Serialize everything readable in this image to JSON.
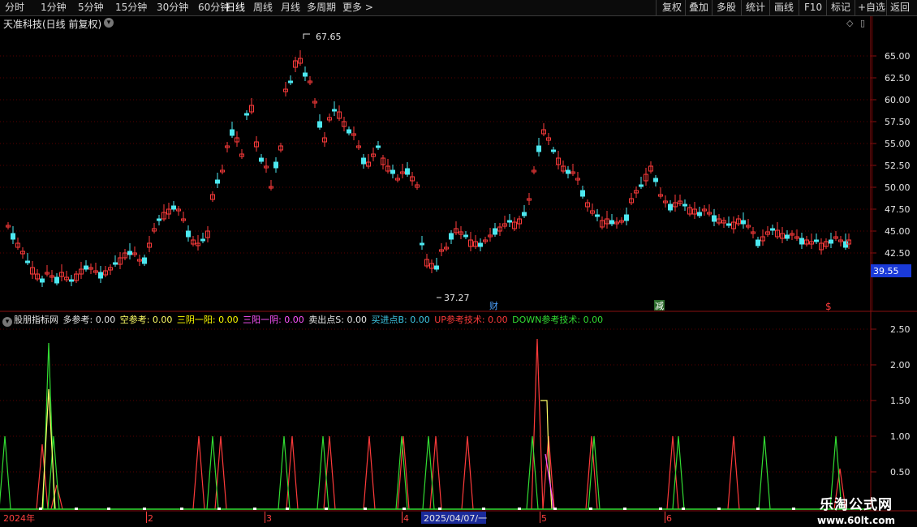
{
  "toolbar": {
    "periods": [
      "分时",
      "1分钟",
      "5分钟",
      "15分钟",
      "30分钟",
      "60分钟",
      "日线",
      "周线",
      "月线",
      "多周期",
      "更多 >"
    ],
    "active": "日线",
    "buttons": [
      "复权",
      "叠加",
      "多股",
      "统计",
      "画线",
      "F10",
      "标记",
      "+自选",
      "返回"
    ]
  },
  "chart": {
    "title": "天准科技(日线 前复权)",
    "price_axis_ticks": [
      "65.00",
      "62.50",
      "60.00",
      "57.50",
      "55.00",
      "52.50",
      "50.00",
      "47.50",
      "45.00",
      "42.50"
    ],
    "current_price": "39.55",
    "high_label": "67.65",
    "low_label": "37.27",
    "markers": [
      {
        "text": "财",
        "color": "#4da3ff"
      },
      {
        "text": "减",
        "color": "#ffffff",
        "bg": "#2a6a2a"
      },
      {
        "text": "$",
        "color": "#ff3b3b"
      }
    ],
    "colors": {
      "up": "#ff3b3b",
      "down": "#4de8f0",
      "grid": "#5a0000",
      "axis": "#8a1010"
    }
  },
  "indicator": {
    "name": "股朋指标网",
    "items": [
      {
        "label": "多参考: 0.00",
        "color": "#e6e6e6"
      },
      {
        "label": "空参考: 0.00",
        "color": "#ffff66"
      },
      {
        "label": "三阴一阳: 0.00",
        "color": "#ffff00"
      },
      {
        "label": "三阳一阴: 0.00",
        "color": "#ff55ff"
      },
      {
        "label": "卖出点S: 0.00",
        "color": "#e6e6e6"
      },
      {
        "label": "买进点B: 0.00",
        "color": "#3ec9e6"
      },
      {
        "label": "UP参考技术: 0.00",
        "color": "#ff3b3b"
      },
      {
        "label": "DOWN参考技术: 0.00",
        "color": "#33dd33"
      }
    ],
    "axis_ticks": [
      "2.50",
      "2.00",
      "1.50",
      "1.00",
      "0.50"
    ]
  },
  "time_axis": {
    "labels": [
      "2024年",
      "2",
      "3",
      "4",
      "5",
      "6"
    ],
    "cursor_date": "2025/04/07/一"
  },
  "watermark": {
    "line1": "乐淘公式网",
    "line2": "www.60lt.com"
  }
}
